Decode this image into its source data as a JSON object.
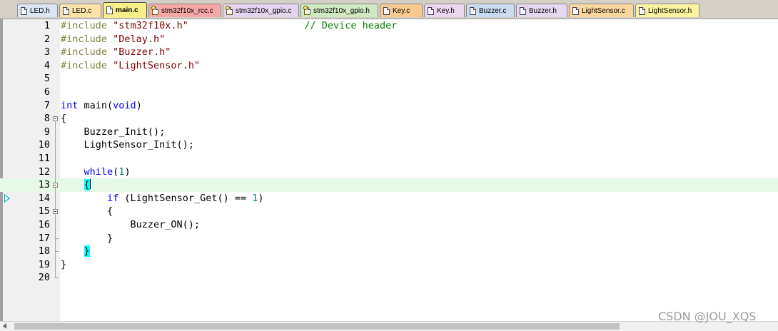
{
  "tabs": [
    {
      "label": "LED.h",
      "color": "#dbe4f3",
      "icon": "header-file-icon",
      "active": false
    },
    {
      "label": "LED.c",
      "color": "#fde3a6",
      "icon": "source-file-icon",
      "active": false
    },
    {
      "label": "main.c",
      "color": "#f6ef8a",
      "icon": "source-file-icon",
      "active": true
    },
    {
      "label": "stm32f10x_rcc.c",
      "color": "#f6a7a7",
      "icon": "library-file-icon",
      "active": false
    },
    {
      "label": "stm32f10x_gpio.c",
      "color": "#e4d4ef",
      "icon": "library-file-icon",
      "active": false
    },
    {
      "label": "stm32f10x_gpio.h",
      "color": "#cfe9c2",
      "icon": "library-file-icon",
      "active": false
    },
    {
      "label": "Key.c",
      "color": "#fbc98f",
      "icon": "source-file-icon",
      "active": false
    },
    {
      "label": "Key.h",
      "color": "#ecd6ef",
      "icon": "header-file-icon",
      "active": false
    },
    {
      "label": "Buzzer.c",
      "color": "#c9dcf2",
      "icon": "source-file-icon",
      "active": false
    },
    {
      "label": "Buzzer.h",
      "color": "#e6d8f1",
      "icon": "header-file-icon",
      "active": false
    },
    {
      "label": "LightSensor.c",
      "color": "#fbd79e",
      "icon": "source-file-icon",
      "active": false
    },
    {
      "label": "LightSensor.h",
      "color": "#faf4a0",
      "icon": "header-file-icon",
      "active": false
    }
  ],
  "editor": {
    "current_line": 13,
    "execution_marker_line": 14,
    "lines": [
      {
        "n": "1",
        "tokens": [
          {
            "t": "#include ",
            "c": "pp"
          },
          {
            "t": "\"stm32f10x.h\"",
            "c": "str"
          },
          {
            "t": "                    ",
            "c": ""
          },
          {
            "t": "// Device header",
            "c": "cmt"
          }
        ]
      },
      {
        "n": "2",
        "tokens": [
          {
            "t": "#include ",
            "c": "pp"
          },
          {
            "t": "\"Delay.h\"",
            "c": "str"
          }
        ]
      },
      {
        "n": "3",
        "tokens": [
          {
            "t": "#include ",
            "c": "pp"
          },
          {
            "t": "\"Buzzer.h\"",
            "c": "str"
          }
        ]
      },
      {
        "n": "4",
        "tokens": [
          {
            "t": "#include ",
            "c": "pp"
          },
          {
            "t": "\"LightSensor.h\"",
            "c": "str"
          }
        ]
      },
      {
        "n": "5",
        "tokens": []
      },
      {
        "n": "6",
        "tokens": []
      },
      {
        "n": "7",
        "tokens": [
          {
            "t": "int",
            "c": "kw"
          },
          {
            "t": " main(",
            "c": ""
          },
          {
            "t": "void",
            "c": "kw"
          },
          {
            "t": ")",
            "c": ""
          }
        ]
      },
      {
        "n": "8",
        "tokens": [
          {
            "t": "{",
            "c": ""
          }
        ]
      },
      {
        "n": "9",
        "tokens": [
          {
            "t": "    Buzzer_Init();",
            "c": ""
          }
        ]
      },
      {
        "n": "10",
        "tokens": [
          {
            "t": "    LightSensor_Init();",
            "c": ""
          }
        ]
      },
      {
        "n": "11",
        "tokens": []
      },
      {
        "n": "12",
        "tokens": [
          {
            "t": "    ",
            "c": ""
          },
          {
            "t": "while",
            "c": "kw"
          },
          {
            "t": "(",
            "c": ""
          },
          {
            "t": "1",
            "c": "num"
          },
          {
            "t": ")",
            "c": ""
          }
        ]
      },
      {
        "n": "13",
        "tokens": [
          {
            "t": "    ",
            "c": ""
          },
          {
            "t": "{",
            "c": "brace-hl",
            "caret": true
          }
        ]
      },
      {
        "n": "14",
        "tokens": [
          {
            "t": "        ",
            "c": ""
          },
          {
            "t": "if",
            "c": "kw"
          },
          {
            "t": " (LightSensor_Get() == ",
            "c": ""
          },
          {
            "t": "1",
            "c": "num"
          },
          {
            "t": ")",
            "c": ""
          }
        ]
      },
      {
        "n": "15",
        "tokens": [
          {
            "t": "        {",
            "c": ""
          }
        ]
      },
      {
        "n": "16",
        "tokens": [
          {
            "t": "            Buzzer_ON();",
            "c": ""
          }
        ]
      },
      {
        "n": "17",
        "tokens": [
          {
            "t": "        }",
            "c": ""
          }
        ]
      },
      {
        "n": "18",
        "tokens": [
          {
            "t": "    ",
            "c": ""
          },
          {
            "t": "}",
            "c": "brace-hl"
          }
        ]
      },
      {
        "n": "19",
        "tokens": [
          {
            "t": "}",
            "c": ""
          }
        ]
      },
      {
        "n": "20",
        "tokens": []
      }
    ]
  },
  "watermark": "CSDN @JOU_XQS"
}
